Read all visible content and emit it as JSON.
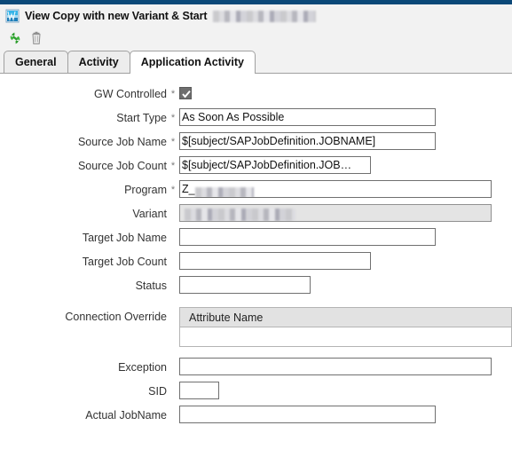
{
  "window": {
    "title_prefix": "View Copy with new Variant & Start",
    "title_redacted": true,
    "icon": "window-document-icon",
    "accent_color": "#0b4878"
  },
  "toolbar": {
    "buttons": [
      {
        "name": "refresh-icon",
        "label": "Refresh",
        "color": "#2f9e2f"
      },
      {
        "name": "delete-icon",
        "label": "Delete",
        "color": "#8a8a8a"
      }
    ]
  },
  "tabs": [
    {
      "label": "General",
      "active": false
    },
    {
      "label": "Activity",
      "active": false
    },
    {
      "label": "Application Activity",
      "active": true
    }
  ],
  "form": {
    "required_marker": "*",
    "fields": [
      {
        "label": "GW Controlled",
        "required": true,
        "type": "checkbox",
        "checked": true,
        "value": ""
      },
      {
        "label": "Start Type",
        "required": true,
        "type": "text",
        "value": "As Soon As Possible",
        "size": "lg"
      },
      {
        "label": "Source Job Name",
        "required": true,
        "type": "text",
        "value": "$[subject/SAPJobDefinition.JOBNAME]",
        "size": "lg"
      },
      {
        "label": "Source Job Count",
        "required": true,
        "type": "text",
        "value": "$[subject/SAPJobDefinition.JOB…",
        "size": "md"
      },
      {
        "label": "Program",
        "required": true,
        "type": "text-redacted",
        "value": "Z_",
        "size": "xl"
      },
      {
        "label": "Variant",
        "required": false,
        "type": "redacted-disabled",
        "value": "",
        "size": "xl"
      },
      {
        "label": "Target Job Name",
        "required": false,
        "type": "text",
        "value": "",
        "size": "lg"
      },
      {
        "label": "Target Job Count",
        "required": false,
        "type": "text",
        "value": "",
        "size": "md"
      },
      {
        "label": "Status",
        "required": false,
        "type": "text",
        "value": "",
        "size": "sm"
      },
      {
        "label": "Connection Override",
        "required": false,
        "type": "grid",
        "value": ""
      },
      {
        "label": "Exception",
        "required": false,
        "type": "text",
        "value": "",
        "size": "xl"
      },
      {
        "label": "SID",
        "required": false,
        "type": "text",
        "value": "",
        "size": "xs"
      },
      {
        "label": "Actual JobName",
        "required": false,
        "type": "text",
        "value": "",
        "size": "lg"
      }
    ],
    "connection_override": {
      "columns": [
        "Attribute Name"
      ],
      "rows": []
    }
  }
}
